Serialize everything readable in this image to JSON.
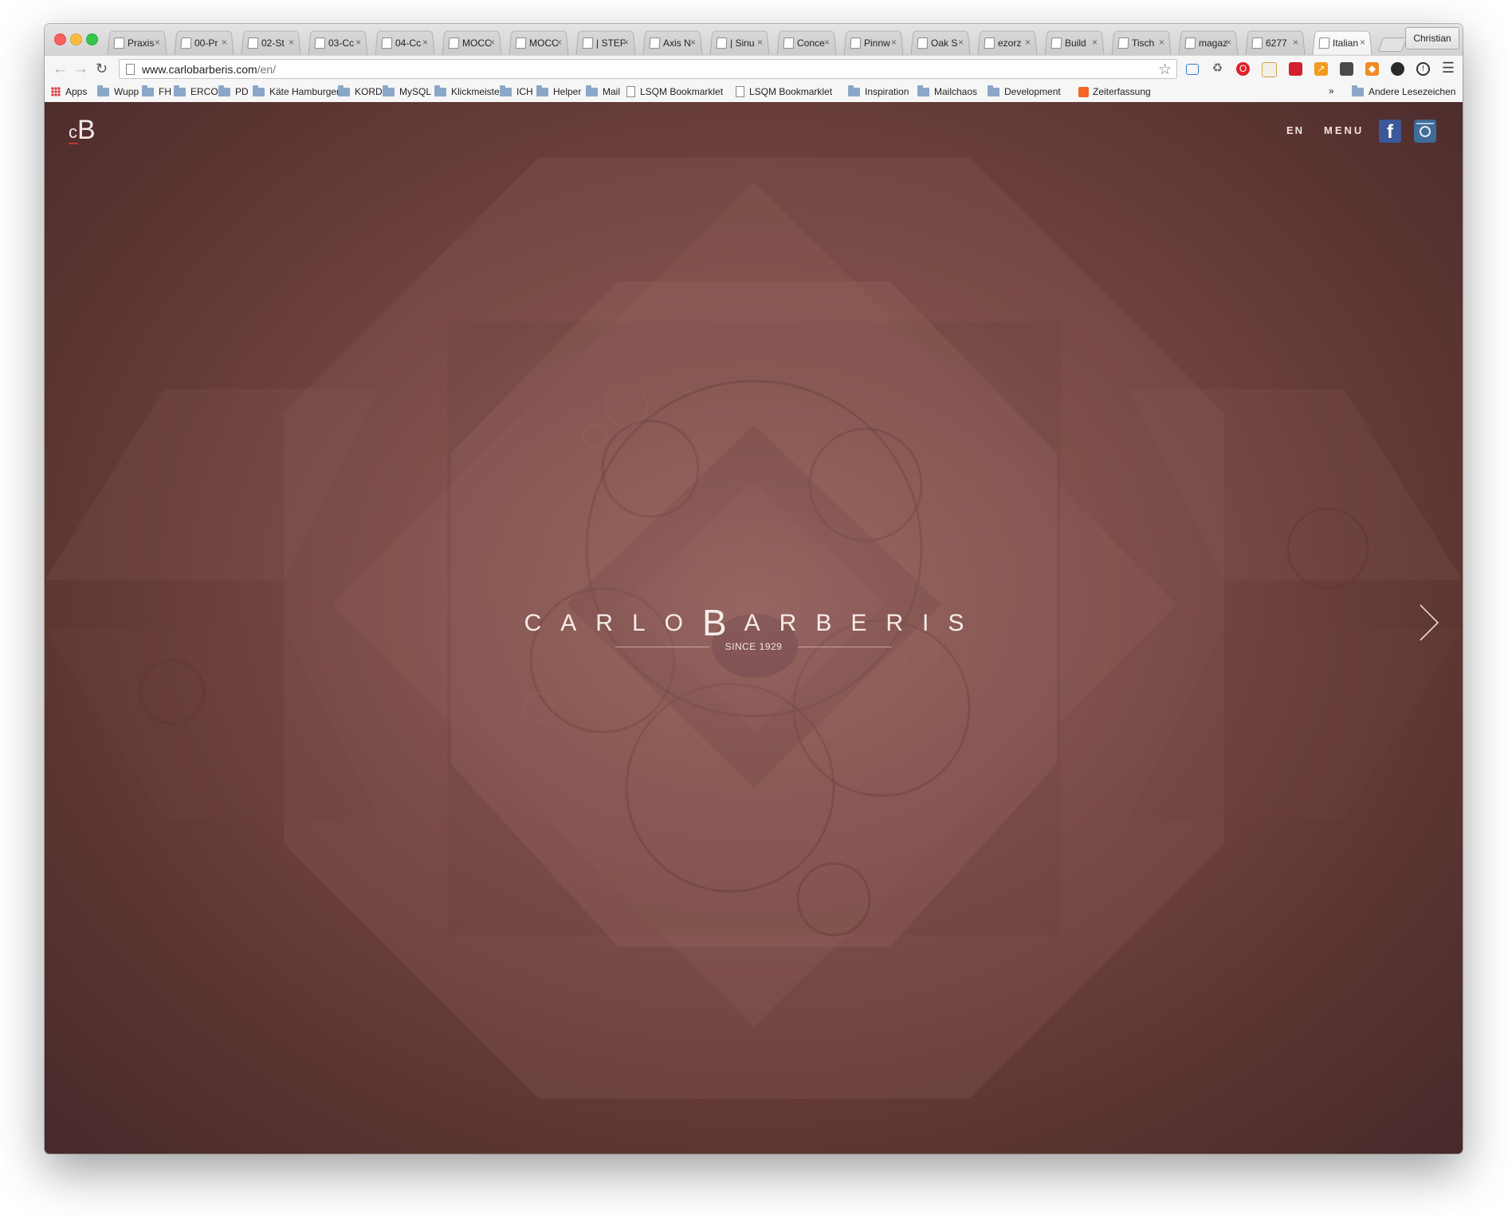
{
  "browser": {
    "tabs": [
      {
        "label": "Praxis",
        "icon": "document-icon"
      },
      {
        "label": "00-Pr",
        "icon": "document-icon"
      },
      {
        "label": "02-St",
        "icon": "document-icon"
      },
      {
        "label": "03-Cc",
        "icon": "document-icon"
      },
      {
        "label": "04-Cc",
        "icon": "document-icon"
      },
      {
        "label": "MOCC",
        "icon": "globe-icon"
      },
      {
        "label": "MOCC",
        "icon": "globe-icon"
      },
      {
        "label": "| STEF",
        "icon": "document-icon"
      },
      {
        "label": "Axis N",
        "icon": "document-icon"
      },
      {
        "label": "| Sinu",
        "icon": "document-icon"
      },
      {
        "label": "Conce",
        "icon": "document-icon"
      },
      {
        "label": "Pinnw",
        "icon": "document-icon"
      },
      {
        "label": "Oak S",
        "icon": "o-icon"
      },
      {
        "label": "ezorz",
        "icon": "red-badge-icon"
      },
      {
        "label": "Build",
        "icon": "stack-icon"
      },
      {
        "label": "Tisch",
        "icon": "hi-icon"
      },
      {
        "label": "magaz",
        "icon": "google-icon"
      },
      {
        "label": "6277",
        "icon": "tape-icon"
      },
      {
        "label": "Italian",
        "icon": "cb-icon",
        "active": true
      }
    ],
    "close_glyph": "×",
    "profile_name": "Christian",
    "url_host": "www.carlobarberis.com",
    "url_path": "/en/",
    "bookmarks": [
      {
        "label": "Apps",
        "type": "apps"
      },
      {
        "label": "Wupp",
        "type": "folder"
      },
      {
        "label": "FH",
        "type": "folder"
      },
      {
        "label": "ERCO",
        "type": "folder"
      },
      {
        "label": "PD",
        "type": "folder"
      },
      {
        "label": "Käte Hamburger",
        "type": "folder"
      },
      {
        "label": "KORD",
        "type": "folder"
      },
      {
        "label": "MySQL",
        "type": "folder"
      },
      {
        "label": "Klickmeister",
        "type": "folder"
      },
      {
        "label": "ICH",
        "type": "folder"
      },
      {
        "label": "Helper",
        "type": "folder"
      },
      {
        "label": "Mail",
        "type": "folder"
      },
      {
        "label": "LSQM Bookmarklet",
        "type": "doc"
      },
      {
        "label": "LSQM Bookmarklet",
        "type": "doc"
      },
      {
        "label": "Inspiration",
        "type": "folder"
      },
      {
        "label": "Mailchaos",
        "type": "folder"
      },
      {
        "label": "Development",
        "type": "folder"
      },
      {
        "label": "Zeiterfassung",
        "type": "soundcloud"
      }
    ],
    "bookmarks_overflow": "»",
    "other_bookmarks": "Andere Lesezeichen"
  },
  "site": {
    "logo_c": "c",
    "logo_b": "B",
    "lang": "EN",
    "menu": "MENU",
    "facebook_glyph": "f",
    "brand_part1": "CARLO",
    "brand_b": "B",
    "brand_part2": "ARBERIS",
    "since": "SINCE 1929"
  },
  "colors": {
    "accent": "#c0392b",
    "background": "#744541",
    "facebook": "#3b5998"
  }
}
